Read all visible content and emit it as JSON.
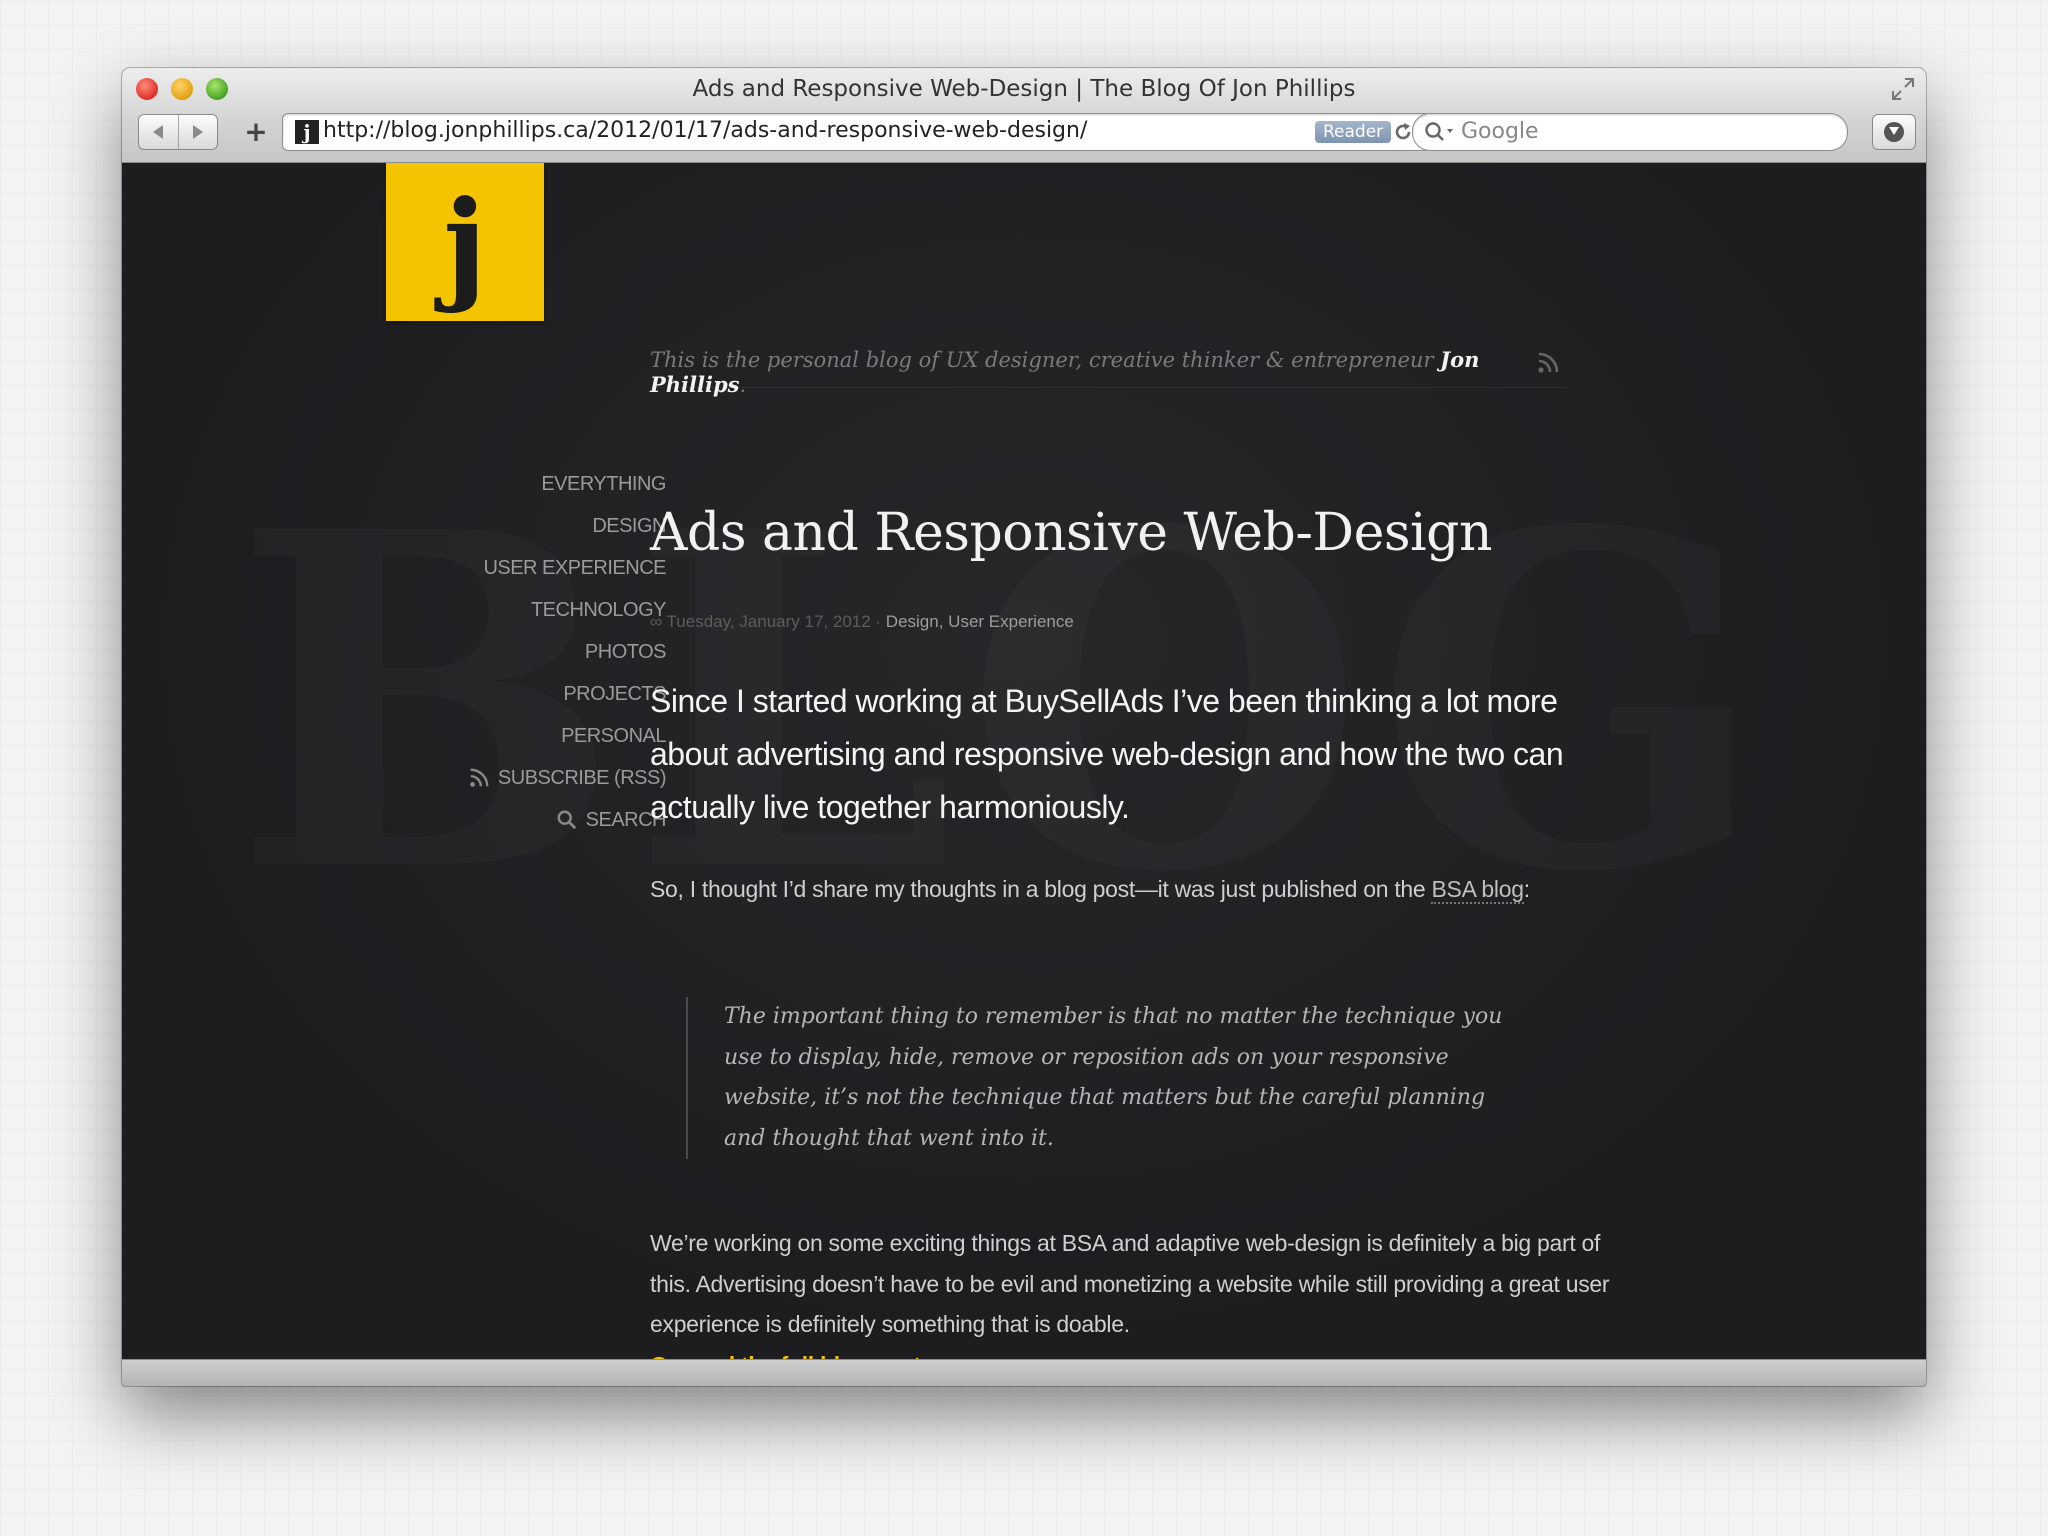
{
  "window": {
    "title": "Ads and Responsive Web-Design | The Blog Of Jon Phillips"
  },
  "toolbar": {
    "url": "http://blog.jonphillips.ca/2012/01/17/ads-and-responsive-web-design/",
    "reader_label": "Reader",
    "search_placeholder": "Google",
    "add_label": "+"
  },
  "site": {
    "logo_letter": "j",
    "tagline": "This is the personal blog of UX designer, creative thinker & entrepreneur",
    "author": "Jon Phillips",
    "tagline_end": ".",
    "background_word": "BLOG",
    "accent_color": "#f5c400"
  },
  "nav": {
    "items": [
      {
        "label": "EVERYTHING",
        "icon": ""
      },
      {
        "label": "DESIGN",
        "icon": ""
      },
      {
        "label": "USER EXPERIENCE",
        "icon": ""
      },
      {
        "label": "TECHNOLOGY",
        "icon": ""
      },
      {
        "label": "PHOTOS",
        "icon": ""
      },
      {
        "label": "PROJECTS",
        "icon": ""
      },
      {
        "label": "PERSONAL",
        "icon": ""
      },
      {
        "label": "SUBSCRIBE (RSS)",
        "icon": "rss-icon"
      },
      {
        "label": "SEARCH",
        "icon": "search-icon"
      }
    ]
  },
  "post": {
    "title": "Ads and Responsive Web-Design",
    "permalink_symbol": "∞",
    "date": "Tuesday, January 17, 2012",
    "separator": " · ",
    "categories": "Design, User Experience",
    "lead": "Since I started working at BuySellAds I’ve been thinking a lot more about advertising and responsive web-design and how the two can actually live together harmoniously.",
    "para1_before": "So, I thought I’d share my thoughts in a blog post—it was just published on the ",
    "para1_link": "BSA blog",
    "para1_after": ":",
    "quote": "The important thing to remember is that no matter the technique you use to display, hide, remove or reposition ads on your responsive website, it’s not the technique that matters but the careful planning and thought that went into it.",
    "para2": "We’re working on some exciting things at BSA and adaptive web-design is definitely a big part of this. Advertising doesn’t have to be evil and monetizing a website while still providing a great user experience is definitely something that is doable.",
    "read_more": "Go read the full blog post →"
  }
}
